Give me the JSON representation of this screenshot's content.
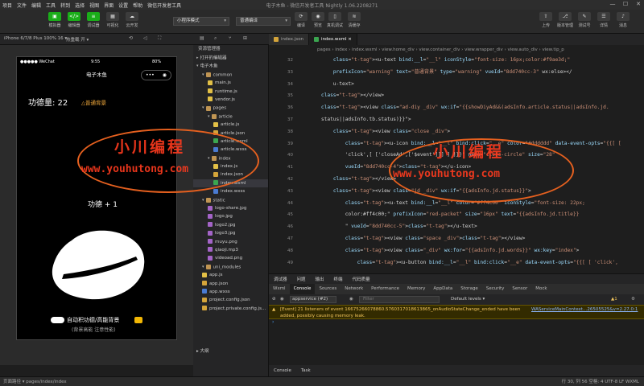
{
  "window_title": "电子木鱼 - 微信开发者工具 Nightly 1.06.2208271",
  "menu": [
    "项目",
    "文件",
    "编辑",
    "工具",
    "转到",
    "选择",
    "视图",
    "界面",
    "设置",
    "帮助",
    "微信开发者工具"
  ],
  "toolbar": {
    "left": [
      "模拟器",
      "编辑器",
      "调试器",
      "可视化",
      "云开发"
    ],
    "mode_select": "小程序模式",
    "compile_select": "普通编译",
    "middle": [
      "编译",
      "预览",
      "真机调试",
      "清缓存"
    ],
    "right": [
      "上传",
      "版本管理",
      "测试号",
      "详情",
      "消息"
    ]
  },
  "device": {
    "label": "iPhone 6/7/8 Plus 100% 16 ▾",
    "hotreload": "热重载 开 ▾"
  },
  "phone": {
    "carrier": "●●●●● WeChat",
    "time": "9:55",
    "battery": "80%",
    "nav_title": "电子木鱼",
    "merit_count": "功德量: 22",
    "bg_label": "△普通背景",
    "merit_plus": "功德 + 1",
    "auto_label": "自动积功德/高能背景",
    "sub_label": "(背景高能 注意性能)"
  },
  "explorer": {
    "title": "资源管理器",
    "open_editors": "打开的编辑器",
    "project": "电子木鱼",
    "outline": "大纲",
    "items": [
      {
        "name": "common",
        "type": "folder",
        "level": 1
      },
      {
        "name": "main.js",
        "type": "js",
        "level": 2
      },
      {
        "name": "runtime.js",
        "type": "js",
        "level": 2
      },
      {
        "name": "vendor.js",
        "type": "js",
        "level": 2
      },
      {
        "name": "pages",
        "type": "folder",
        "level": 1
      },
      {
        "name": "article",
        "type": "folder",
        "level": 2
      },
      {
        "name": "article.js",
        "type": "js",
        "level": 3
      },
      {
        "name": "article.json",
        "type": "json",
        "level": 3
      },
      {
        "name": "article.wxml",
        "type": "wxml",
        "level": 3
      },
      {
        "name": "article.wxss",
        "type": "wxss",
        "level": 3
      },
      {
        "name": "index",
        "type": "folder",
        "level": 2
      },
      {
        "name": "index.js",
        "type": "js",
        "level": 3
      },
      {
        "name": "index.json",
        "type": "json",
        "level": 3
      },
      {
        "name": "index.wxml",
        "type": "wxml",
        "level": 3,
        "selected": true
      },
      {
        "name": "index.wxss",
        "type": "wxss",
        "level": 3
      },
      {
        "name": "static",
        "type": "folder",
        "level": 1
      },
      {
        "name": "logo-share.jpg",
        "type": "img",
        "level": 2
      },
      {
        "name": "logo.jpg",
        "type": "img",
        "level": 2
      },
      {
        "name": "logo2.jpg",
        "type": "img",
        "level": 2
      },
      {
        "name": "logo3.jpg",
        "type": "img",
        "level": 2
      },
      {
        "name": "muyu.png",
        "type": "img",
        "level": 2
      },
      {
        "name": "qiaoji.mp3",
        "type": "img",
        "level": 2
      },
      {
        "name": "videoad.png",
        "type": "img",
        "level": 2
      },
      {
        "name": "uni_modules",
        "type": "folder",
        "level": 1
      },
      {
        "name": "app.js",
        "type": "js",
        "level": 1
      },
      {
        "name": "app.json",
        "type": "json",
        "level": 1
      },
      {
        "name": "app.wxss",
        "type": "wxss",
        "level": 1
      },
      {
        "name": "project.config.json",
        "type": "json",
        "level": 1
      },
      {
        "name": "project.private.config.js...",
        "type": "json",
        "level": 1
      }
    ]
  },
  "editor": {
    "tabs": [
      "index.json",
      "index.wxml"
    ],
    "breadcrumb": "pages › index › index.wxml › view.home_div › view.container_div › view.wrapper_div › view.auto_div › view.tip_p",
    "line_numbers": [
      "32",
      "33",
      "34",
      "35",
      "36",
      "37",
      "38",
      "39",
      "40",
      "41",
      "42",
      "43",
      "44",
      "45",
      "46",
      "47",
      "48",
      "49"
    ],
    "lines": [
      "        <u-text bind:__l=\"__l\" iconStyle=\"font-size: 16px;color:#f9ae3d;\"",
      "        prefixIcon=\"warning\" text=\"普通背景\" type=\"warning\" vueId=\"8dd740cc-3\" wx:else></",
      "        u-text>",
      "    </view>",
      "    <view class=\"ad-diy _div\" wx:if=\"{{showDiyAd&&(adsInfo.article.status||adsInfo.jd.",
      "    status||adsInfo.tb.status)}}\">",
      "        <view class=\"close _div\">",
      "            <u-icon bind:__l=\"__l\" bind:click=\"__e\" color=\"#dddddd\" data-event-opts=\"{{[ [",
      "            'click',[ ['closeAd',['$event']]] ] ]}}\" name=\"close-circle\" size=\"28\"",
      "            vueId=\"8dd740cc-4\"></u-icon>",
      "        </view>",
      "        <view class=\"jd _div\" wx:if=\"{{adsInfo.jd.status}}\">",
      "            <u-text bind:__l=\"__l\" color=\"#ff4c00\" iconStyle=\"font-size: 22px;",
      "            color:#ff4c00;\" prefixIcon=\"red-packet\" size=\"16px\" text=\"{{adsInfo.jd.title}}",
      "            \" vueId=\"8dd740cc-5\"></u-text>",
      "            <view class=\"space _div\"></view>",
      "            <view class=\"_div\" wx:for=\"{{adsInfo.jd.words}}\" wx:key=\"index\">",
      "                <u-button bind:__l=\"__l\" bind:click=\"__e\" data-event-opts=\"{{[ [ 'click',"
    ]
  },
  "console": {
    "top_tabs": [
      "调试器",
      "问题",
      "输出",
      "终端",
      "代码质量"
    ],
    "tabs": [
      "Wxml",
      "Console",
      "Sources",
      "Network",
      "Performance",
      "Memory",
      "AppData",
      "Storage",
      "Security",
      "Sensor",
      "Mock"
    ],
    "active_tab": "Console",
    "context": "appservice (#2)",
    "filter_placeholder": "Filter",
    "levels": "Default levels ▾",
    "warning": "[Event] 21 listeners of event 16675266078860.5760317018613865_onAudioStateChange_ended have been added, possibly causing memory leak.",
    "warning_source": "WAServiceMainContext…26505525&v=2.27.0:1",
    "badge": "1",
    "bottom_tabs": [
      "Console",
      "Task"
    ]
  },
  "statusbar": {
    "left": "页面路径 ▾   pages/index/index",
    "right": "行 30, 列 56   空格: 4   UTF-8   LF   WXML"
  },
  "watermark": {
    "cn": "小川编程",
    "url": "www.youhutong.com"
  }
}
